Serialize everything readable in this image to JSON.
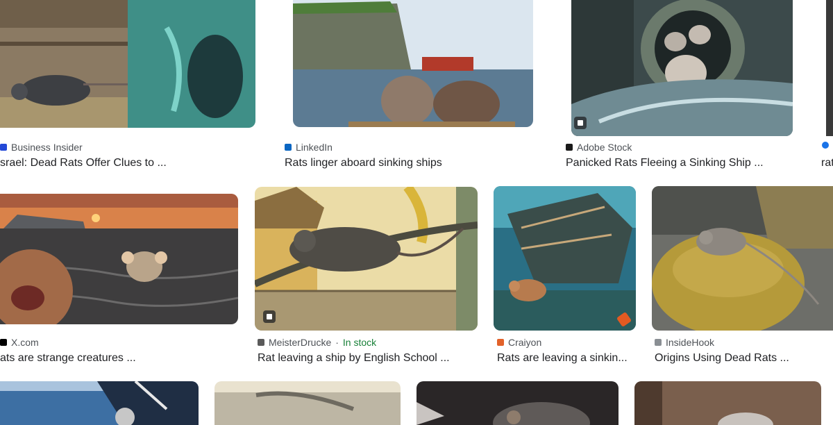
{
  "results": [
    {
      "source": "Business Insider",
      "title": "srael: Dead Rats Offer Clues to ..."
    },
    {
      "source": "LinkedIn",
      "title": "Rats linger aboard sinking ships"
    },
    {
      "source": "Adobe Stock",
      "title": "Panicked Rats Fleeing a Sinking Ship ..."
    },
    {
      "source": "",
      "title": "rat"
    },
    {
      "source": "X.com",
      "title": "ats are strange creatures ..."
    },
    {
      "source": "MeisterDrucke",
      "stock": "In stock",
      "title": "Rat leaving a ship by English School ..."
    },
    {
      "source": "Craiyon",
      "title": "Rats are leaving a sinkin..."
    },
    {
      "source": "InsideHook",
      "title": "Origins Using Dead Rats ..."
    }
  ],
  "separator": "·",
  "icons": {
    "business_insider": "business-insider-favicon",
    "linkedin": "linkedin-favicon",
    "adobe": "adobe-stock-favicon",
    "x": "x-favicon",
    "meister": "meisterdrucke-favicon",
    "craiyon": "craiyon-favicon",
    "insidehook": "insidehook-favicon"
  },
  "colors": {
    "source_text": "#4d5156",
    "title_text": "#202124",
    "stock_green": "#188038"
  }
}
